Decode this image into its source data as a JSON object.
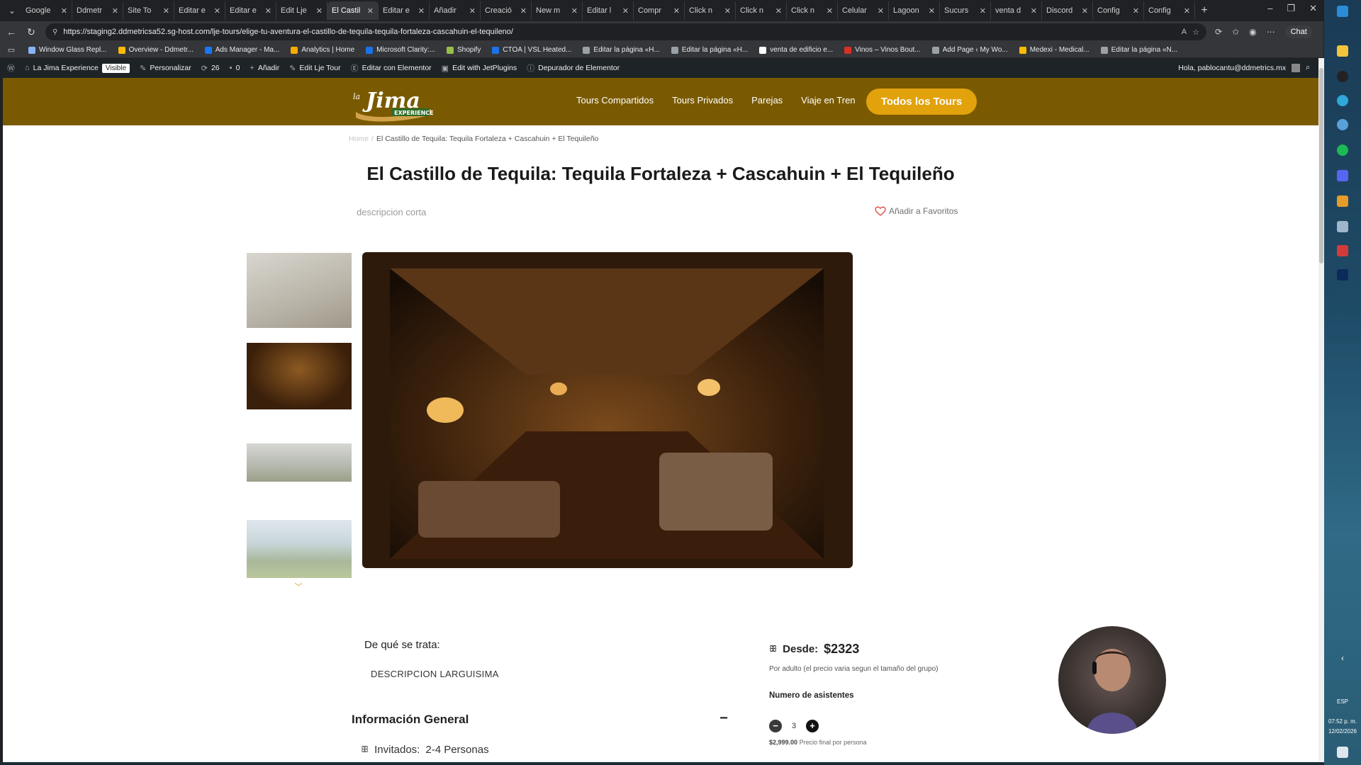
{
  "browser": {
    "tabs": [
      {
        "label": "Google",
        "color": "#4285f4"
      },
      {
        "label": "Ddmetr",
        "color": "#1a73e8"
      },
      {
        "label": "Site To",
        "color": "#ffffff"
      },
      {
        "label": "Editar e",
        "color": "#2e9e4f"
      },
      {
        "label": "Editar e",
        "color": "#2e9e4f"
      },
      {
        "label": "Edit Lje",
        "color": "#2e9e4f"
      },
      {
        "label": "El Castil",
        "color": "#2e9e4f",
        "active": true
      },
      {
        "label": "Editar e",
        "color": "#2e9e4f"
      },
      {
        "label": "Añadir",
        "color": "#6b3fd9"
      },
      {
        "label": "Creació",
        "color": "#1e6fd9"
      },
      {
        "label": "New m",
        "color": "#d93025"
      },
      {
        "label": "Editar l",
        "color": "#5f6368"
      },
      {
        "label": "Compr",
        "color": "#5f6368"
      },
      {
        "label": "Click n",
        "color": "#5f6368"
      },
      {
        "label": "Click n",
        "color": "#5f6368"
      },
      {
        "label": "Click n",
        "color": "#5f6368"
      },
      {
        "label": "Celular",
        "color": "#5f6368"
      },
      {
        "label": "Lagoon",
        "color": "#5f6368"
      },
      {
        "label": "Sucurs",
        "color": "#5f6368"
      },
      {
        "label": "venta d",
        "color": "#5f6368"
      },
      {
        "label": "Discord",
        "color": "#5865f2"
      },
      {
        "label": "Config",
        "color": "#1a73e8"
      },
      {
        "label": "Config",
        "color": "#1a73e8"
      }
    ],
    "url": "https://staging2.ddmetricsa52.sg-host.com/lje-tours/elige-tu-aventura-el-castillo-de-tequila-tequila-fortaleza-cascahuin-el-tequileno/",
    "chat_label": "Chat",
    "bookmarks": [
      {
        "label": "Window Glass Repl...",
        "color": "#8ab4f8"
      },
      {
        "label": "Overview - Ddmetr...",
        "color": "#fbbc04"
      },
      {
        "label": "Ads Manager - Ma...",
        "color": "#1877f2"
      },
      {
        "label": "Analytics | Home",
        "color": "#f9ab00"
      },
      {
        "label": "Microsoft Clarity:...",
        "color": "#1a73e8"
      },
      {
        "label": "Shopify",
        "color": "#95bf47"
      },
      {
        "label": "CTOA | VSL Heated...",
        "color": "#1a73e8"
      },
      {
        "label": "Editar la página «H...",
        "color": "#9aa0a6"
      },
      {
        "label": "Editar la página «H...",
        "color": "#9aa0a6"
      },
      {
        "label": "venta de edificio e...",
        "color": "#ffffff"
      },
      {
        "label": "Vinos – Vinos Bout...",
        "color": "#d93025"
      },
      {
        "label": "Add Page ‹ My Wo...",
        "color": "#9aa0a6"
      },
      {
        "label": "Medexi - Medical...",
        "color": "#fbbc04"
      },
      {
        "label": "Editar la página «N...",
        "color": "#9aa0a6"
      }
    ]
  },
  "wpbar": {
    "site_name": "La Jima Experience",
    "visible_badge": "Visible",
    "personalize": "Personalizar",
    "updates": "26",
    "comments": "0",
    "add": "Añadir",
    "edit_tour": "Edit Lje Tour",
    "edit_elementor": "Editar con Elementor",
    "jetplugins": "Edit with JetPlugins",
    "debugger": "Depurador de Elementor",
    "greeting": "Hola, pablocantu@ddmetrics.mx"
  },
  "site": {
    "logo_text": "Jima",
    "logo_sub": "EXPERIENCE",
    "logo_prefix": "la",
    "nav": [
      "Tours Compartidos",
      "Tours Privados",
      "Parejas",
      "Viaje en Tren"
    ],
    "cta": "Todos los Tours",
    "colors": {
      "header": "#7a5a00",
      "cta": "#e2a20c",
      "accent": "#d59a18"
    }
  },
  "breadcrumb": {
    "home": "Home",
    "current": "El Castillo de Tequila: Tequila Fortaleza + Cascahuin + El Tequileño"
  },
  "product": {
    "title": "El Castillo de Tequila: Tequila Fortaleza + Cascahuin + El Tequileño",
    "short_description": "descripcion corta",
    "favorites": "Añadir a Favoritos",
    "about_label": "De qué se trata:",
    "about_text": "DESCRIPCION LARGUISIMA",
    "general_info": "Información General",
    "guests_label": "Invitados:",
    "guests_value": "2-4 Personas",
    "price_label": "Desde:",
    "price_value": "$2323",
    "price_note": "Por adulto (el precio varia segun el tamaño del grupo)",
    "attendees_label": "Numero de asistentes",
    "attendees_value": "3",
    "final_price": "$2,999.00",
    "final_note": "Precio final por persona"
  },
  "system": {
    "time": "07:52 p. m.",
    "date": "12/02/2026",
    "lang": "ESP"
  }
}
